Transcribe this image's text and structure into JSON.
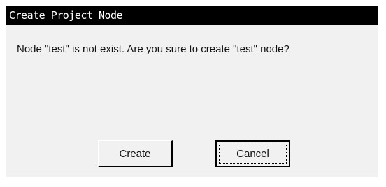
{
  "window": {
    "title": "Create Project Node"
  },
  "dialog": {
    "message": "Node \"test\" is not exist. Are you sure to create \"test\" node?"
  },
  "buttons": {
    "create_label": "Create",
    "cancel_label": "Cancel"
  }
}
